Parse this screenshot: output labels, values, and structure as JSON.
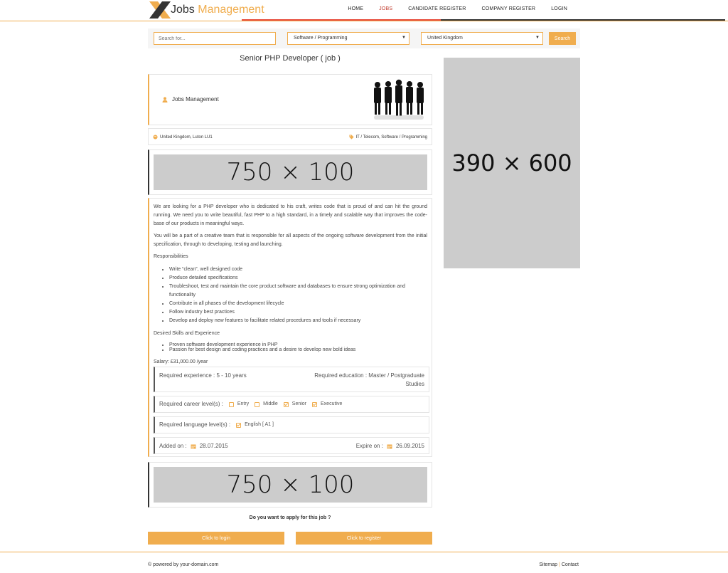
{
  "header": {
    "logo_part1": "Jobs",
    "logo_part2": "Management",
    "nav": [
      "HOME",
      "JOBS",
      "CANDIDATE REGISTER",
      "COMPANY REGISTER",
      "LOGIN"
    ]
  },
  "search": {
    "placeholder": "Search for...",
    "category": "Software / Programming",
    "location": "United Kingdom",
    "button": "Search"
  },
  "job": {
    "title": "Senior PHP Developer ( job )",
    "company": "Jobs Management",
    "location": "United Kingdom, Luton LU1",
    "categories": "IT / Telecom, Software / Programming",
    "description_p1": "We are looking for a PHP developer who is dedicated to his craft, writes code that is proud of and can hit the ground running. We need you to write beautiful, fast PHP to a high standard, in a timely and scalable way that improves the code-base of our products in meaningful ways.",
    "description_p2": "You will be a part of a creative team that is responsible for all aspects of the ongoing software development from the initial specification, through to developing, testing and launching.",
    "responsibilities_title": "Responsibilities",
    "responsibilities": [
      "Write “clean”, well designed code",
      "Produce detailed specifications",
      "Troubleshoot, test and maintain the core product software and databases to ensure strong optimization and functionality",
      "Contribute in all phases of the development lifecycle",
      "Follow industry best practices",
      "Develop and deploy new features to facilitate related procedures and tools if necessary"
    ],
    "skills_title": "Desired Skills and Experience",
    "skills": [
      "Proven software development experience in PHP",
      "Passion for best design and coding practices and a desire to develop new bold ideas"
    ],
    "salary": "Salary: £31,000.00 /year",
    "experience": "Required experience : 5 - 10 years",
    "education": "Required education : Master / Postgraduate Studies",
    "career_label": "Required career level(s) :",
    "career_levels": [
      {
        "label": "Entry",
        "checked": false
      },
      {
        "label": "Middle",
        "checked": false
      },
      {
        "label": "Senior",
        "checked": true
      },
      {
        "label": "Executive",
        "checked": true
      }
    ],
    "language_label": "Required language level(s) :",
    "language": "English [ A1 ]",
    "added_label": "Added on :",
    "added_date": "28.07.2015",
    "expire_label": "Expire on :",
    "expire_date": "26.09.2015"
  },
  "ads": {
    "banner": "750 × 100",
    "sidebar": "390 × 600"
  },
  "apply": {
    "question": "Do you want to apply for this job ?",
    "login": "Click to login",
    "register": "Click to register"
  },
  "footer": {
    "copyright": "© powered by your-domain.com",
    "sitemap": "Sitemap",
    "contact": "Contact"
  },
  "colors": {
    "accent": "#f0ad4e",
    "placeholder_gray": "#cccccc"
  }
}
